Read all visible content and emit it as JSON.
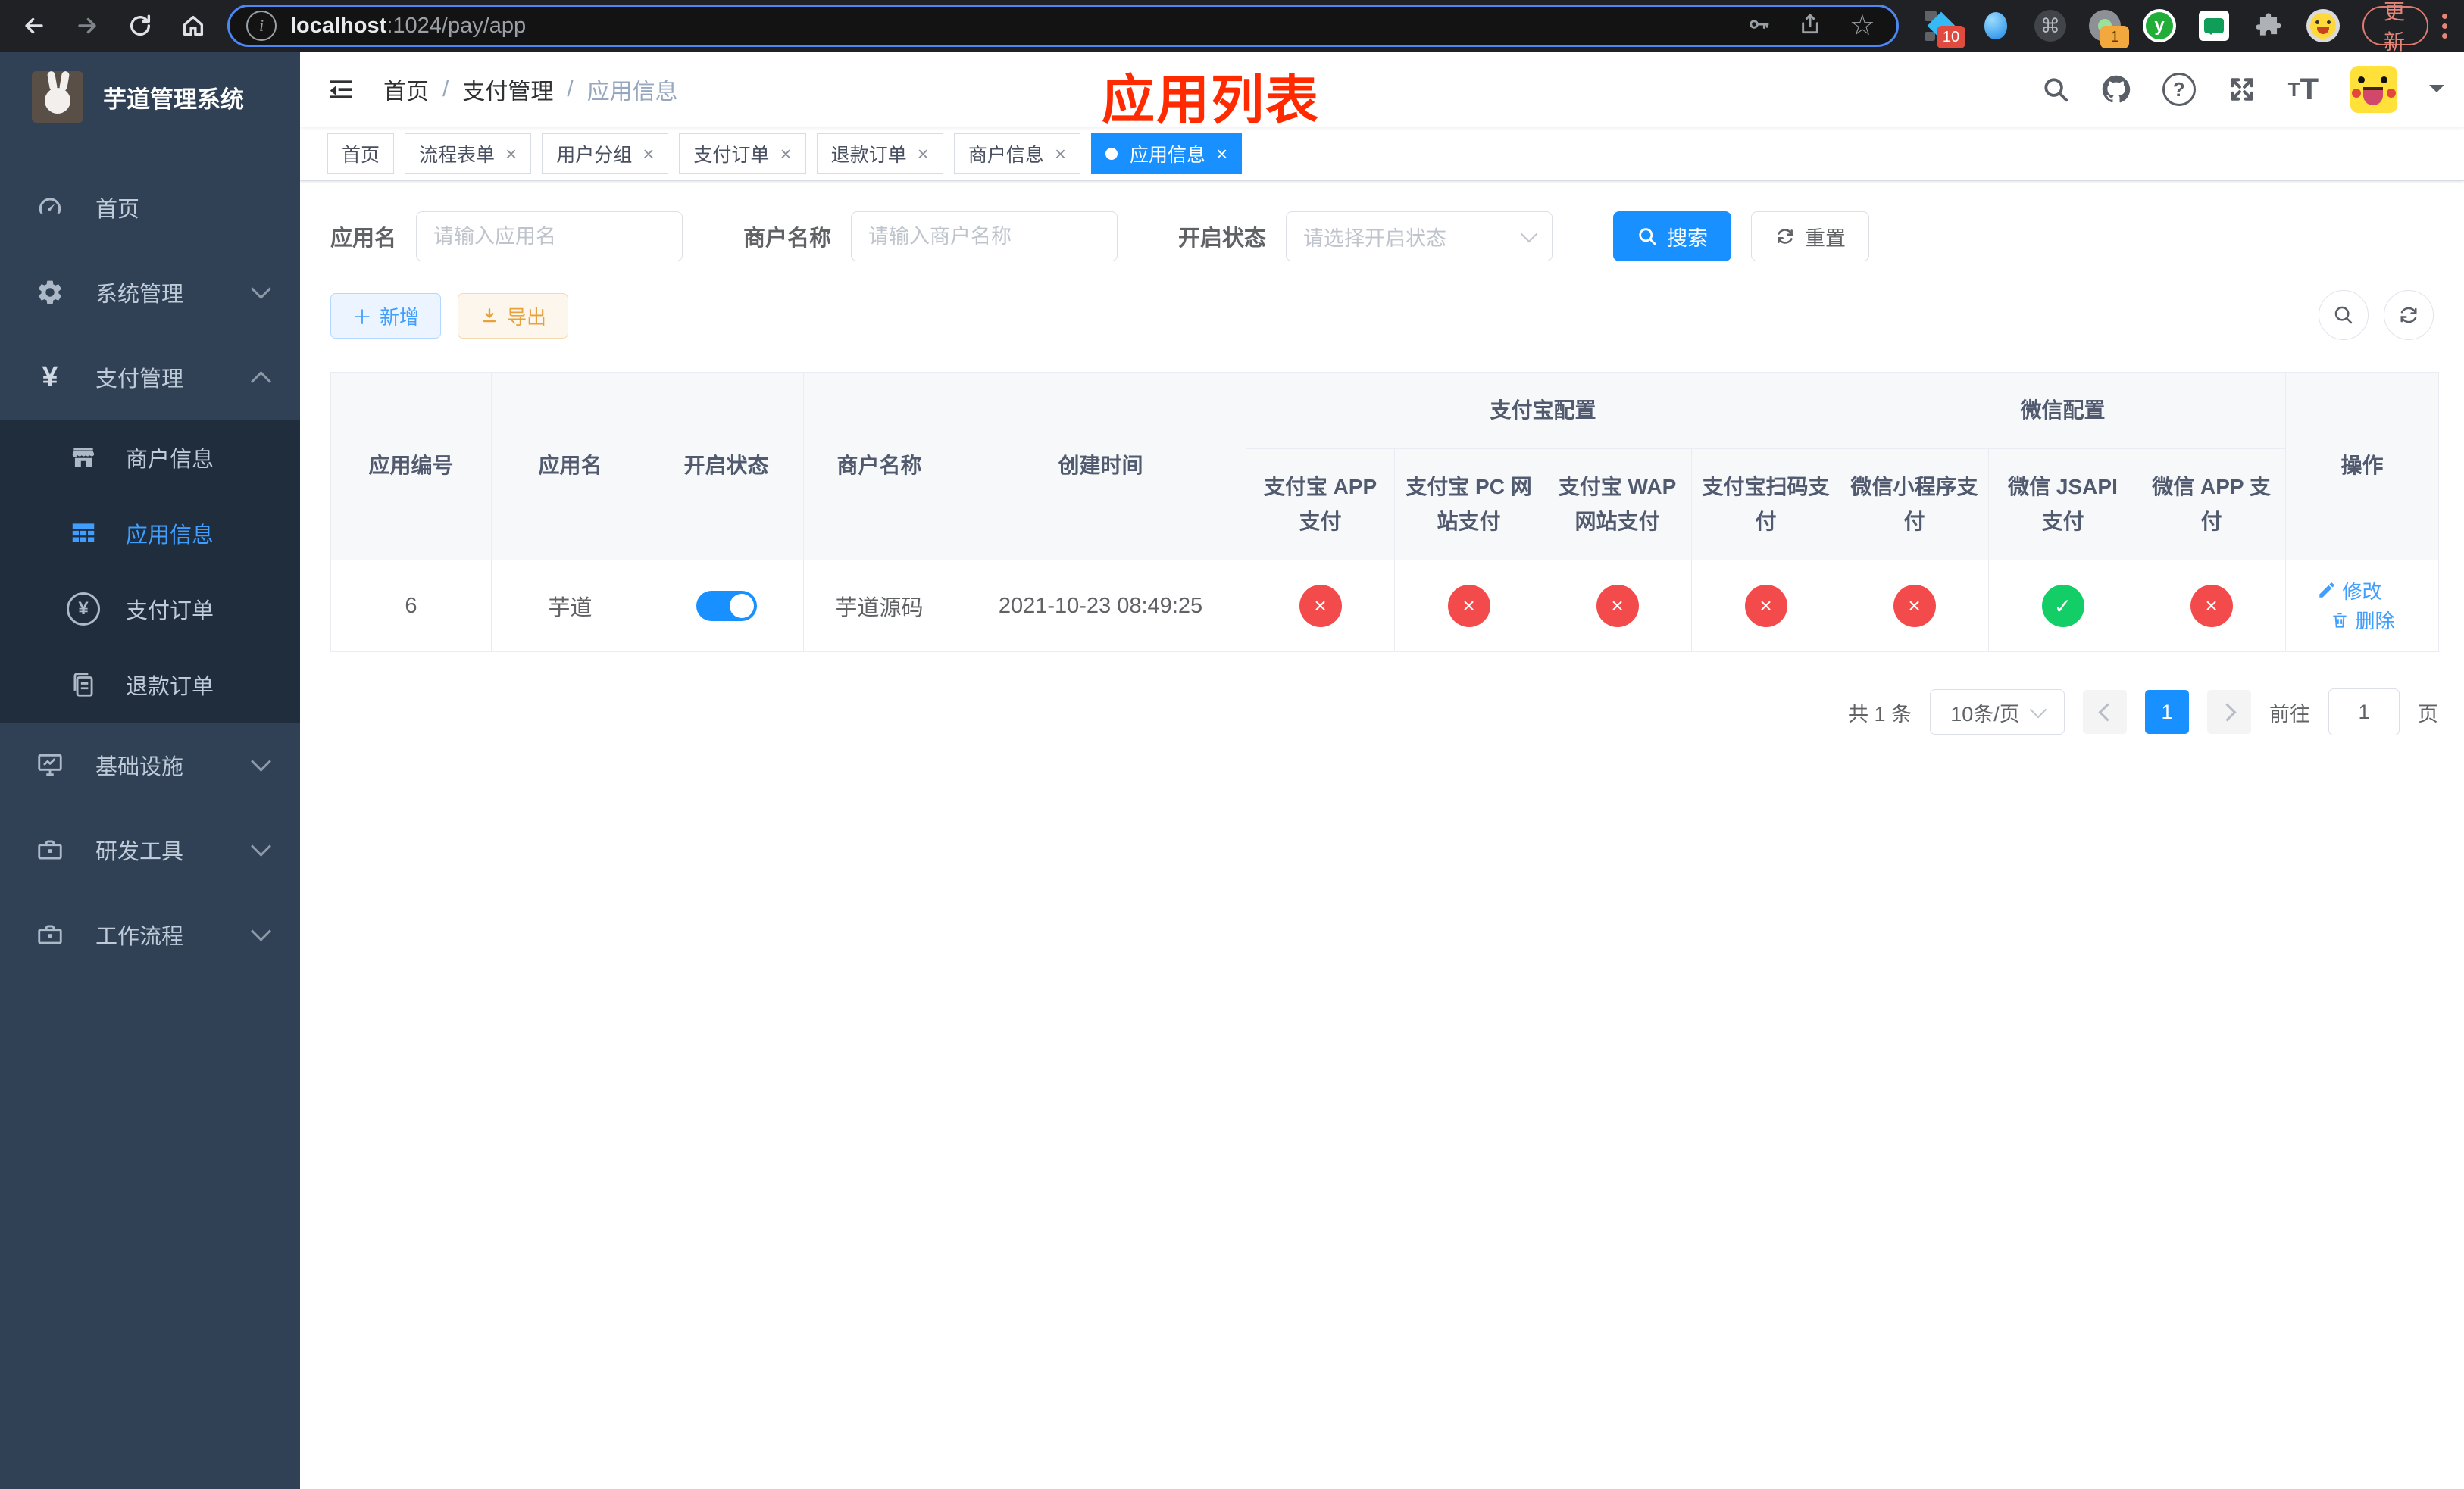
{
  "browser": {
    "url_host": "localhost",
    "url_rest": ":1024/pay/app",
    "star_glyph": "☆",
    "cmd_glyph": "⌘",
    "ext_badge_10": "10",
    "ext_badge_1": "1",
    "ext_y_label": "y",
    "update_button": "更新"
  },
  "sidebar": {
    "title": "芋道管理系统",
    "pay_icon_glyph": "¥",
    "pay_order_icon_glyph": "¥",
    "items": [
      {
        "label": "首页"
      },
      {
        "label": "系统管理"
      },
      {
        "label": "支付管理"
      },
      {
        "label": "商户信息"
      },
      {
        "label": "应用信息"
      },
      {
        "label": "支付订单"
      },
      {
        "label": "退款订单"
      },
      {
        "label": "基础设施"
      },
      {
        "label": "研发工具"
      },
      {
        "label": "工作流程"
      }
    ]
  },
  "header": {
    "breadcrumb": [
      "首页",
      "支付管理",
      "应用信息"
    ],
    "separator": "/",
    "annotation": "应用列表"
  },
  "tabs": {
    "close_glyph": "×",
    "items": [
      {
        "label": "首页"
      },
      {
        "label": "流程表单"
      },
      {
        "label": "用户分组"
      },
      {
        "label": "支付订单"
      },
      {
        "label": "退款订单"
      },
      {
        "label": "商户信息"
      },
      {
        "label": "应用信息"
      }
    ]
  },
  "filters": {
    "app_name_label": "应用名",
    "app_name_placeholder": "请输入应用名",
    "merchant_label": "商户名称",
    "merchant_placeholder": "请输入商户名称",
    "status_label": "开启状态",
    "status_placeholder": "请选择开启状态",
    "search_button": "搜索",
    "reset_button": "重置"
  },
  "actions": {
    "add_button": "新增",
    "add_glyph": "＋",
    "export_button": "导出"
  },
  "table": {
    "headers": {
      "col_id": "应用编号",
      "col_name": "应用名",
      "col_status": "开启状态",
      "col_merchant": "商户名称",
      "col_created": "创建时间",
      "group_alipay": "支付宝配置",
      "group_wechat": "微信配置",
      "col_op": "操作",
      "channels": [
        "支付宝 APP 支付",
        "支付宝 PC 网站支付",
        "支付宝 WAP 网站支付",
        "支付宝扫码支付",
        "微信小程序支付",
        "微信 JSAPI 支付",
        "微信 APP 支付"
      ]
    },
    "row": {
      "id": "6",
      "name": "芋道",
      "status_on": true,
      "merchant": "芋道源码",
      "created": "2021-10-23 08:49:25",
      "channels": [
        {
          "enabled": false,
          "glyph": "×"
        },
        {
          "enabled": false,
          "glyph": "×"
        },
        {
          "enabled": false,
          "glyph": "×"
        },
        {
          "enabled": false,
          "glyph": "×"
        },
        {
          "enabled": false,
          "glyph": "×"
        },
        {
          "enabled": true,
          "glyph": "✓"
        },
        {
          "enabled": false,
          "glyph": "×"
        }
      ],
      "op_edit": "修改",
      "op_delete": "删除"
    }
  },
  "pagination": {
    "total_text": "共 1 条",
    "page_size": "10条/页",
    "current_page": "1",
    "goto_prefix": "前往",
    "goto_value": "1",
    "goto_suffix": "页"
  },
  "colors": {
    "accent_blue": "#1890ff",
    "link_blue": "#409eff",
    "success_green": "#13ce66",
    "danger_red": "#f34b4b",
    "annotation_red": "#ff2a00",
    "sidebar_bg": "#304156",
    "submenu_bg": "#1f2d3d"
  }
}
